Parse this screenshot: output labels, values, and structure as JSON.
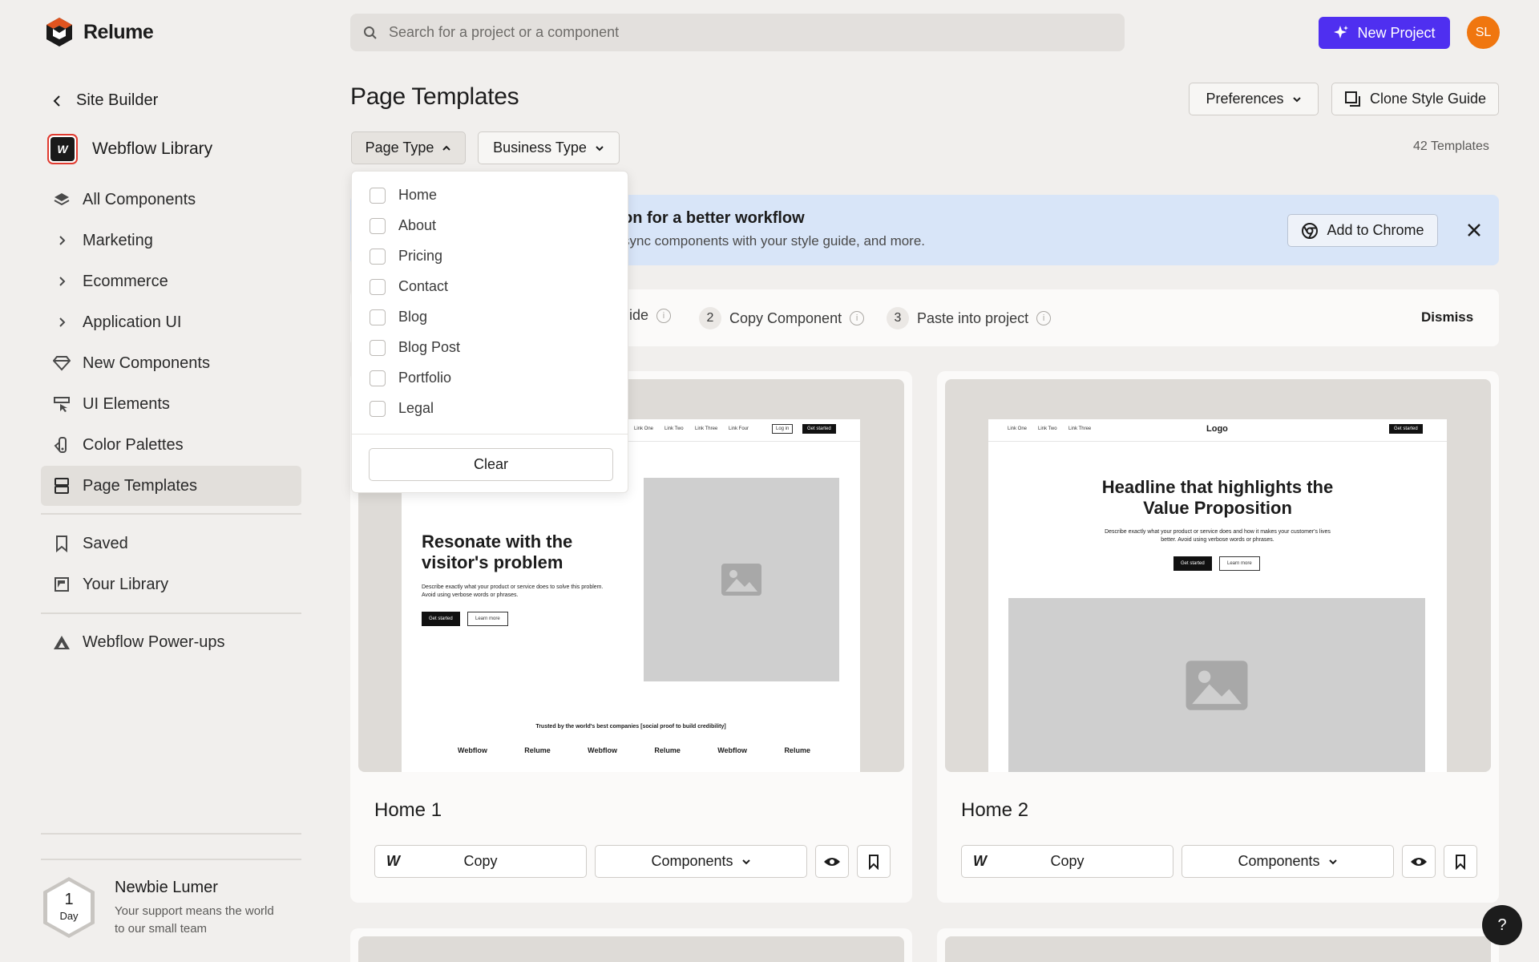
{
  "app": {
    "name": "Relume"
  },
  "search": {
    "placeholder": "Search for a project or a component"
  },
  "header": {
    "new_project": "New Project",
    "avatar_initials": "SL"
  },
  "sidebar": {
    "back_label": "Site Builder",
    "library_name": "Webflow Library",
    "items": [
      {
        "label": "All Components",
        "icon": "layers-icon"
      },
      {
        "label": "Marketing",
        "icon": "chevron-right-icon"
      },
      {
        "label": "Ecommerce",
        "icon": "chevron-right-icon"
      },
      {
        "label": "Application UI",
        "icon": "chevron-right-icon"
      },
      {
        "label": "New Components",
        "icon": "diamond-icon"
      },
      {
        "label": "UI Elements",
        "icon": "cursor-icon"
      },
      {
        "label": "Color Palettes",
        "icon": "palette-icon"
      },
      {
        "label": "Page Templates",
        "icon": "template-icon",
        "active": true
      },
      {
        "label": "Saved",
        "icon": "bookmark-icon"
      },
      {
        "label": "Your Library",
        "icon": "library-icon"
      },
      {
        "label": "Webflow Power-ups",
        "icon": "triangle-icon"
      }
    ],
    "badge": {
      "count": "1",
      "unit": "Day",
      "title": "Newbie Lumer",
      "subtitle": "Your support means the world to our small team"
    }
  },
  "main": {
    "title": "Page Templates",
    "preferences": "Preferences",
    "clone_style_guide": "Clone Style Guide",
    "filters": {
      "page_type": "Page Type",
      "business_type": "Business Type"
    },
    "template_count": "42 Templates",
    "banner": {
      "title": "on for a better workflow",
      "subtitle": "sync components with your style guide, and more.",
      "action": "Add to Chrome"
    },
    "steps": [
      {
        "num": "",
        "label": "uide"
      },
      {
        "num": "2",
        "label": "Copy Component"
      },
      {
        "num": "3",
        "label": "Paste into project"
      }
    ],
    "dismiss": "Dismiss",
    "cards": [
      {
        "name": "Home 1",
        "copy": "Copy",
        "components": "Components",
        "preview": {
          "nav_links": [
            "Link One",
            "Link Two",
            "Link Three",
            "Link Four"
          ],
          "login": "Log in",
          "cta": "Get started",
          "headline": "Resonate with the visitor's problem",
          "body": "Describe exactly what your product or service does to solve this problem. Avoid using verbose words or phrases.",
          "primary": "Get started",
          "secondary": "Learn more",
          "trusted": "Trusted by the world's best companies [social proof to build credibility]",
          "logos": [
            "Webflow",
            "Relume",
            "Webflow",
            "Relume",
            "Webflow",
            "Relume"
          ]
        }
      },
      {
        "name": "Home 2",
        "copy": "Copy",
        "components": "Components",
        "preview": {
          "nav_links": [
            "Link One",
            "Link Two",
            "Link Three"
          ],
          "logo": "Logo",
          "cta": "Get started",
          "headline": "Headline that highlights the Value Proposition",
          "body": "Describe exactly what your product or service does and how it makes your customer's lives better. Avoid using verbose words or phrases.",
          "primary": "Get started",
          "secondary": "Learn more"
        }
      }
    ]
  },
  "dropdown": {
    "options": [
      "Home",
      "About",
      "Pricing",
      "Contact",
      "Blog",
      "Blog Post",
      "Portfolio",
      "Legal"
    ],
    "clear": "Clear"
  },
  "help": "?"
}
